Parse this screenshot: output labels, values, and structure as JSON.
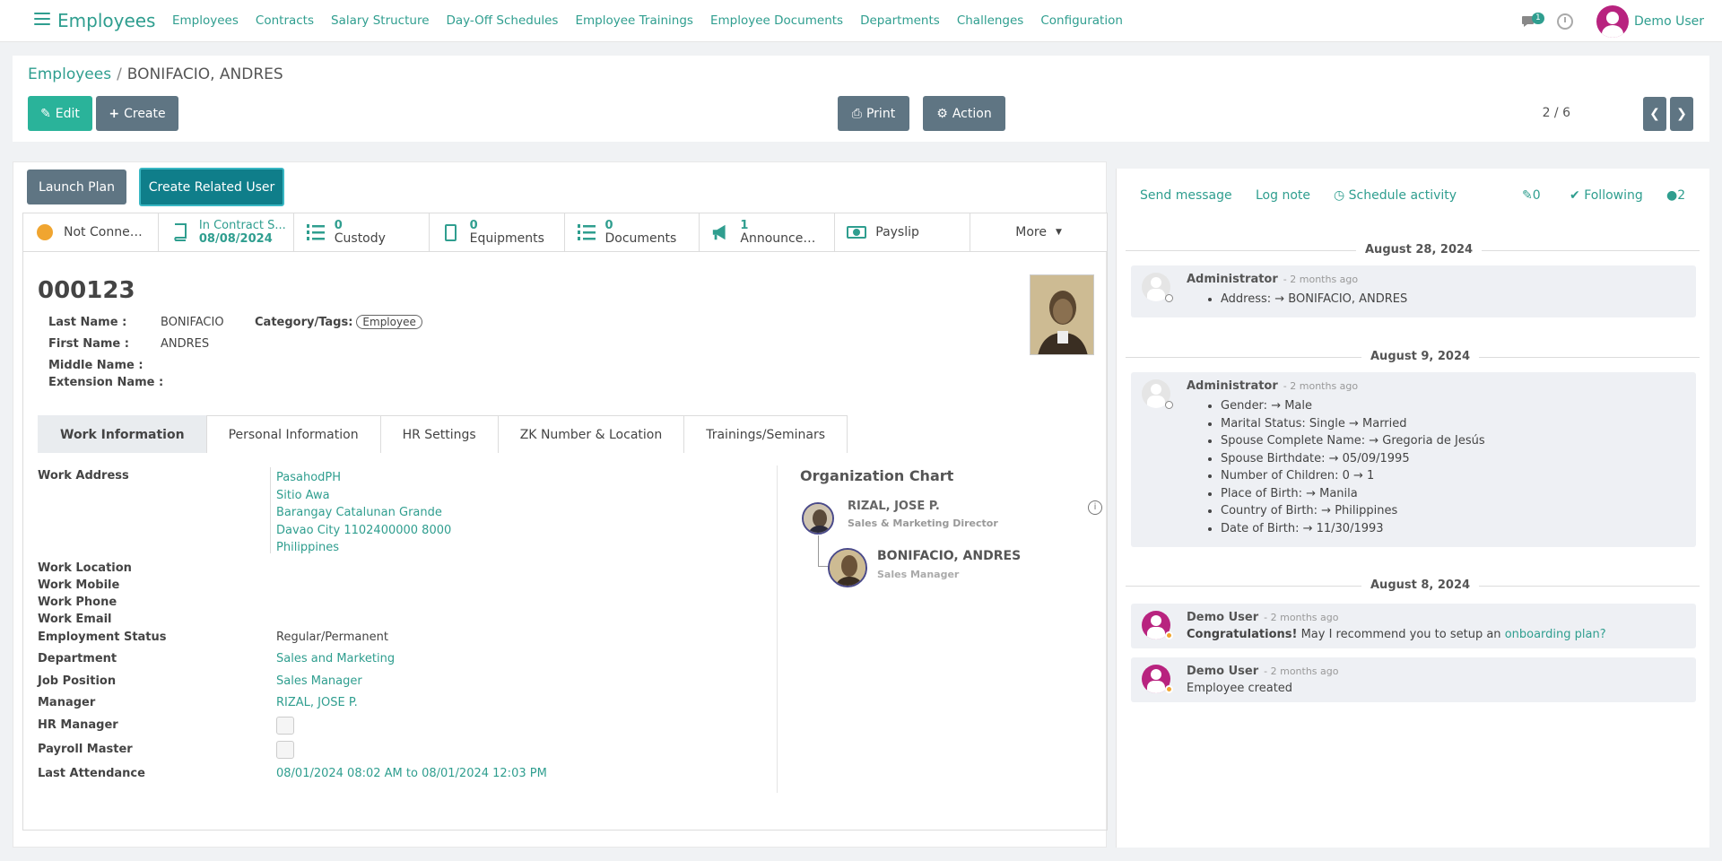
{
  "nav": {
    "app_title": "Employees",
    "menu": [
      "Employees",
      "Contracts",
      "Salary Structure",
      "Day-Off Schedules",
      "Employee Trainings",
      "Employee Documents",
      "Departments",
      "Challenges",
      "Configuration"
    ],
    "chat_badge": "1",
    "user": "Demo User"
  },
  "breadcrumb": {
    "parent": "Employees",
    "current": "BONIFACIO, ANDRES"
  },
  "toolbar": {
    "edit": "Edit",
    "create": "Create",
    "print": "Print",
    "action": "Action",
    "pager": "2 / 6"
  },
  "buttons": {
    "launch_plan": "Launch Plan",
    "create_related_user": "Create Related User"
  },
  "stats": {
    "presence": "Not Connect...",
    "contract_label": "In Contract S...",
    "contract_date": "08/08/2024",
    "custody_num": "0",
    "custody": "Custody",
    "equip_num": "0",
    "equip": "Equipments",
    "docs_num": "0",
    "docs": "Documents",
    "ann_num": "1",
    "ann": "Announcem...",
    "payslip": "Payslip",
    "more": "More"
  },
  "employee": {
    "id": "000123",
    "last_name_label": "Last Name :",
    "last_name": "BONIFACIO",
    "first_name_label": "First Name :",
    "first_name": "ANDRES",
    "middle_name_label": "Middle Name :",
    "ext_name_label": "Extension Name :",
    "tags_label": "Category/Tags:",
    "tag": "Employee"
  },
  "tabs": [
    "Work Information",
    "Personal Information",
    "HR Settings",
    "ZK Number & Location",
    "Trainings/Seminars"
  ],
  "work": {
    "address_label": "Work Address",
    "address": [
      "PasahodPH",
      "Sitio Awa",
      "Barangay Catalunan Grande",
      "Davao City 1102400000 8000",
      "Philippines"
    ],
    "location_label": "Work Location",
    "mobile_label": "Work Mobile",
    "phone_label": "Work Phone",
    "email_label": "Work Email",
    "status_label": "Employment Status",
    "status": "Regular/Permanent",
    "dept_label": "Department",
    "dept": "Sales and Marketing",
    "job_label": "Job Position",
    "job": "Sales Manager",
    "manager_label": "Manager",
    "manager": "RIZAL, JOSE P.",
    "hr_manager_label": "HR Manager",
    "payroll_label": "Payroll Master",
    "attendance_label": "Last Attendance",
    "attendance": "08/01/2024 08:02 AM to 08/01/2024 12:03 PM"
  },
  "org": {
    "title": "Organization Chart",
    "manager_name": "RIZAL, JOSE P.",
    "manager_title": "Sales & Marketing Director",
    "self_name": "BONIFACIO, ANDRES",
    "self_title": "Sales Manager",
    "info": "i"
  },
  "chatter": {
    "send": "Send message",
    "log": "Log note",
    "schedule": "Schedule activity",
    "attach_count": "0",
    "following": "Following",
    "followers": "2",
    "groups": [
      {
        "date": "August 28, 2024",
        "messages": [
          {
            "author": "Administrator",
            "ago": "- 2 months ago",
            "items": [
              "Address: → BONIFACIO, ANDRES"
            ]
          }
        ]
      },
      {
        "date": "August 9, 2024",
        "messages": [
          {
            "author": "Administrator",
            "ago": "- 2 months ago",
            "items": [
              "Gender: → Male",
              "Marital Status: Single → Married",
              "Spouse Complete Name: → Gregoria de Jesús",
              "Spouse Birthdate: → 05/09/1995",
              "Number of Children: 0 → 1",
              "Place of Birth: → Manila",
              "Country of Birth: → Philippines",
              "Date of Birth: → 11/30/1993"
            ]
          }
        ]
      },
      {
        "date": "August 8, 2024",
        "messages": [
          {
            "author": "Demo User",
            "ago": "- 2 months ago",
            "bold": "Congratulations!",
            "text": " May I recommend you to setup an ",
            "link": "onboarding plan?"
          },
          {
            "author": "Demo User",
            "ago": "- 2 months ago",
            "text": "Employee created"
          }
        ]
      }
    ]
  }
}
